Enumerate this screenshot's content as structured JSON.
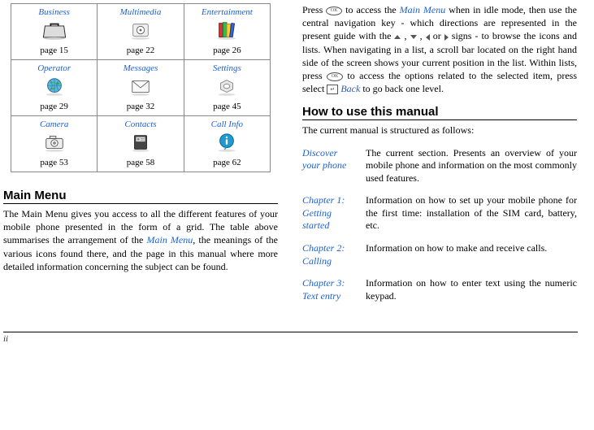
{
  "grid": [
    {
      "title": "Business",
      "page": "page 15"
    },
    {
      "title": "Multimedia",
      "page": "page 22"
    },
    {
      "title": "Entertainment",
      "page": "page 26"
    },
    {
      "title": "Operator",
      "page": "page 29"
    },
    {
      "title": "Messages",
      "page": "page 32"
    },
    {
      "title": "Settings",
      "page": "page 45"
    },
    {
      "title": "Camera",
      "page": "page 53"
    },
    {
      "title": "Contacts",
      "page": "page 58"
    },
    {
      "title": "Call Info",
      "page": "page 62"
    }
  ],
  "heading1": "Main Menu",
  "para1_a": "The Main Menu gives you access to all the different features of your mobile phone presented in the form of a grid. The table above summarises the arrangement of the ",
  "para1_link": "Main Menu",
  "para1_b": ", the meanings of the various icons found there, and the page in this manual where more detailed information concerning the subject can be found.",
  "para2_a": "Press ",
  "para2_b": " to access the ",
  "para2_link1": "Main Menu",
  "para2_c": " when in idle mode, then use the central navigation key - which directions are represented in the present guide with the ",
  "comma": " , ",
  "orw": " or ",
  "para2_d": " signs - to browse the icons and lists. When navigating in a list, a scroll bar located on the right hand side of the screen shows your current position in the list. Within lists, press ",
  "para2_e": " to access the options related to the selected item, press select ",
  "para2_link2": "Back",
  "para2_f": " to go back one level.",
  "heading2": "How to use this manual",
  "para3": "The current manual is structured as follows:",
  "chapters": [
    {
      "label": "Discover your phone",
      "desc": "The current section. Presents an overview of your mobile phone and information on the most commonly used features."
    },
    {
      "label": "Chapter 1: Getting started",
      "desc": "Information on how to set up your mobile phone for the first time: installation of the SIM card, battery, etc."
    },
    {
      "label": "Chapter 2: Calling",
      "desc": "Information on how to make and receive calls."
    },
    {
      "label": "Chapter 3: Text entry",
      "desc": "Information on how to enter text using the numeric keypad."
    }
  ],
  "footer": "ii"
}
